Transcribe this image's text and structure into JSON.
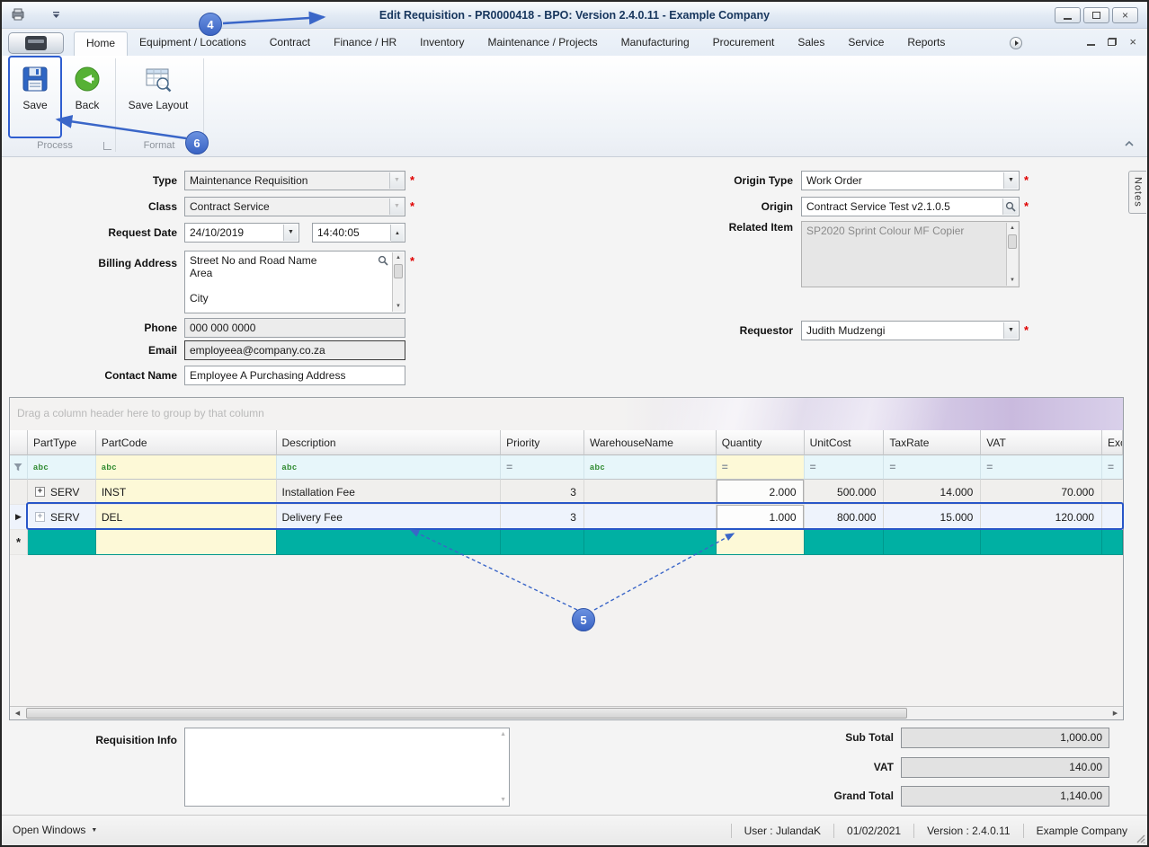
{
  "window": {
    "title": "Edit Requisition - PR0000418 - BPO: Version 2.4.0.11 - Example Company",
    "notes_tab": "Notes"
  },
  "ribbon": {
    "tabs": [
      "Home",
      "Equipment / Locations",
      "Contract",
      "Finance / HR",
      "Inventory",
      "Maintenance / Projects",
      "Manufacturing",
      "Procurement",
      "Sales",
      "Service",
      "Reports"
    ],
    "active_tab": "Home",
    "buttons": {
      "save": "Save",
      "back": "Back",
      "save_layout": "Save Layout"
    },
    "groups": {
      "process": "Process",
      "format": "Format"
    }
  },
  "form": {
    "type_label": "Type",
    "type_value": "Maintenance Requisition",
    "class_label": "Class",
    "class_value": "Contract Service",
    "request_date_label": "Request Date",
    "request_date_value": "24/10/2019",
    "request_time_value": "14:40:05",
    "billing_address_label": "Billing Address",
    "billing_address_value": "Street No and Road Name\nArea\n\nCity",
    "phone_label": "Phone",
    "phone_value": "000 000 0000",
    "email_label": "Email",
    "email_value": "employeea@company.co.za",
    "contact_label": "Contact Name",
    "contact_value": "Employee A Purchasing Address",
    "origin_type_label": "Origin Type",
    "origin_type_value": "Work Order",
    "origin_label": "Origin",
    "origin_value": "Contract Service Test v2.1.0.5",
    "related_item_label": "Related Item",
    "related_item_value": "SP2020 Sprint Colour MF Copier",
    "requestor_label": "Requestor",
    "requestor_value": "Judith Mudzengi"
  },
  "grid": {
    "group_by_hint": "Drag a column header here to group by that column",
    "columns": [
      "PartType",
      "PartCode",
      "Description",
      "Priority",
      "WarehouseName",
      "Quantity",
      "UnitCost",
      "TaxRate",
      "VAT",
      "Exc"
    ],
    "rows": [
      {
        "part_type": "SERV",
        "part_code": "INST",
        "description": "Installation Fee",
        "priority": "3",
        "warehouse": "",
        "quantity": "2.000",
        "unit_cost": "500.000",
        "tax_rate": "14.000",
        "vat": "70.000"
      },
      {
        "part_type": "SERV",
        "part_code": "DEL",
        "description": "Delivery Fee",
        "priority": "3",
        "warehouse": "",
        "quantity": "1.000",
        "unit_cost": "800.000",
        "tax_rate": "15.000",
        "vat": "120.000"
      }
    ]
  },
  "footer": {
    "requisition_info_label": "Requisition Info",
    "sub_total_label": "Sub Total",
    "sub_total_value": "1,000.00",
    "vat_label": "VAT",
    "vat_value": "140.00",
    "grand_total_label": "Grand Total",
    "grand_total_value": "1,140.00"
  },
  "status_bar": {
    "open_windows": "Open Windows",
    "user": "User : JulandaK",
    "date": "01/02/2021",
    "version": "Version : 2.4.0.11",
    "company": "Example Company"
  },
  "annotations": {
    "step4": "4",
    "step5": "5",
    "step6": "6"
  },
  "icons": {
    "dropdown": "▼",
    "up": "▲",
    "down": "▼",
    "left": "◀",
    "right": "▶",
    "close": "×",
    "expand": "+",
    "current_row": "▶",
    "new_row": "*",
    "abc_filter": "abc",
    "equals_filter": "="
  }
}
